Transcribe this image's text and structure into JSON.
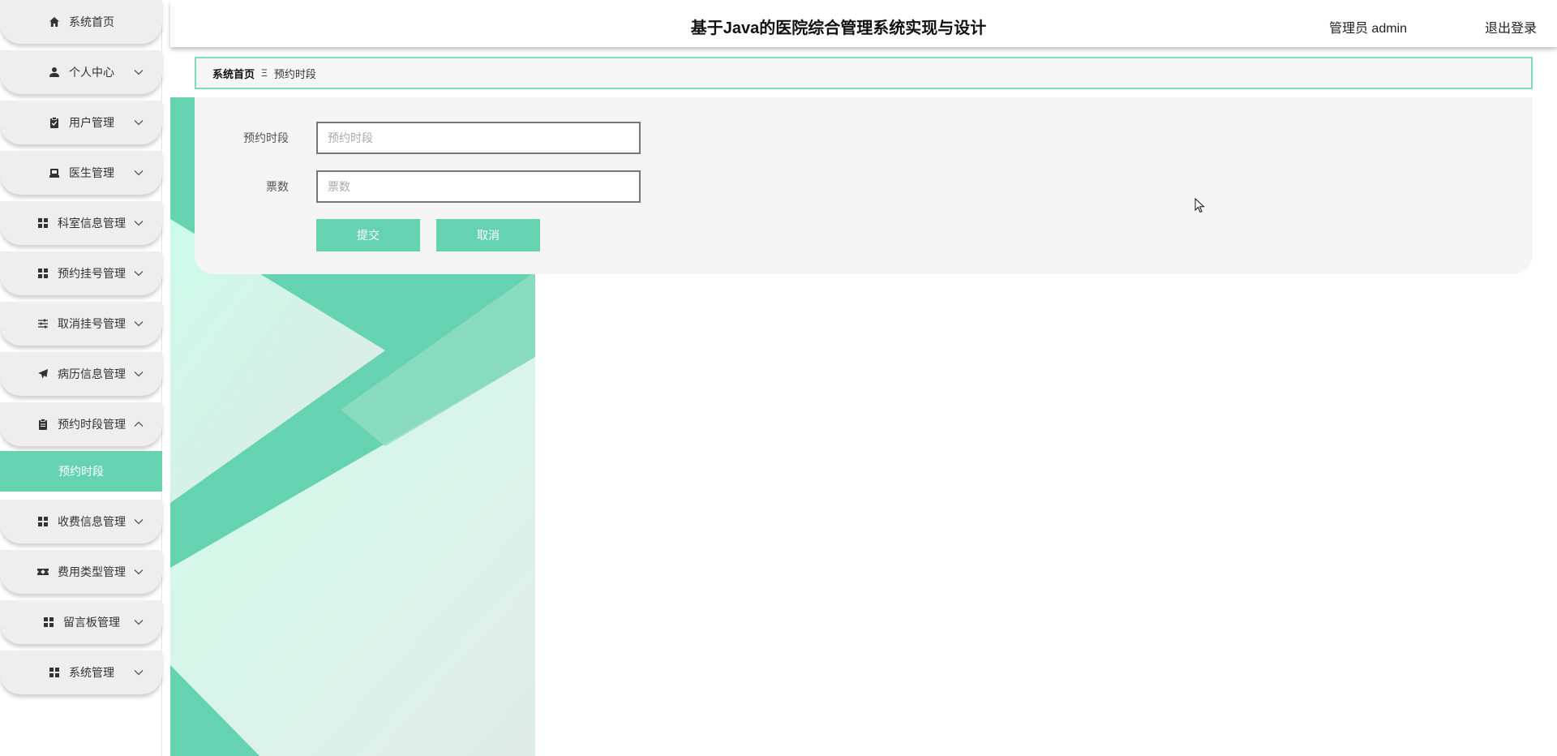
{
  "header": {
    "title": "基于Java的医院综合管理系统实现与设计",
    "user": "管理员 admin",
    "logout": "退出登录"
  },
  "sidebar": {
    "items": [
      {
        "label": "系统首页",
        "icon": "home-icon",
        "expandable": false
      },
      {
        "label": "个人中心",
        "icon": "user-icon",
        "expandable": true
      },
      {
        "label": "用户管理",
        "icon": "clipboard-check-icon",
        "expandable": true
      },
      {
        "label": "医生管理",
        "icon": "briefcase-icon",
        "expandable": true
      },
      {
        "label": "科室信息管理",
        "icon": "grid-icon",
        "expandable": true
      },
      {
        "label": "预约挂号管理",
        "icon": "grid-icon",
        "expandable": true
      },
      {
        "label": "取消挂号管理",
        "icon": "sliders-icon",
        "expandable": true
      },
      {
        "label": "病历信息管理",
        "icon": "send-icon",
        "expandable": true
      },
      {
        "label": "预约时段管理",
        "icon": "clipboard-icon",
        "expandable": true,
        "expanded": true
      },
      {
        "label": "收费信息管理",
        "icon": "grid-icon",
        "expandable": true
      },
      {
        "label": "费用类型管理",
        "icon": "ticket-icon",
        "expandable": true
      },
      {
        "label": "留言板管理",
        "icon": "grid-icon",
        "expandable": true
      },
      {
        "label": "系统管理",
        "icon": "grid-icon",
        "expandable": true
      }
    ],
    "active_submenu": "预约时段"
  },
  "breadcrumb": {
    "home": "系统首页",
    "separator": "Ξ",
    "current": "预约时段"
  },
  "form": {
    "fields": [
      {
        "label": "预约时段",
        "value": "",
        "placeholder": "预约时段"
      },
      {
        "label": "票数",
        "value": "",
        "placeholder": "票数"
      }
    ],
    "submit_label": "提交",
    "cancel_label": "取消"
  },
  "colors": {
    "accent": "#66d3b0",
    "accent_border": "#7fdbbd",
    "menu_bg": "#eeeeee",
    "card_bg": "#f6f5f5"
  }
}
